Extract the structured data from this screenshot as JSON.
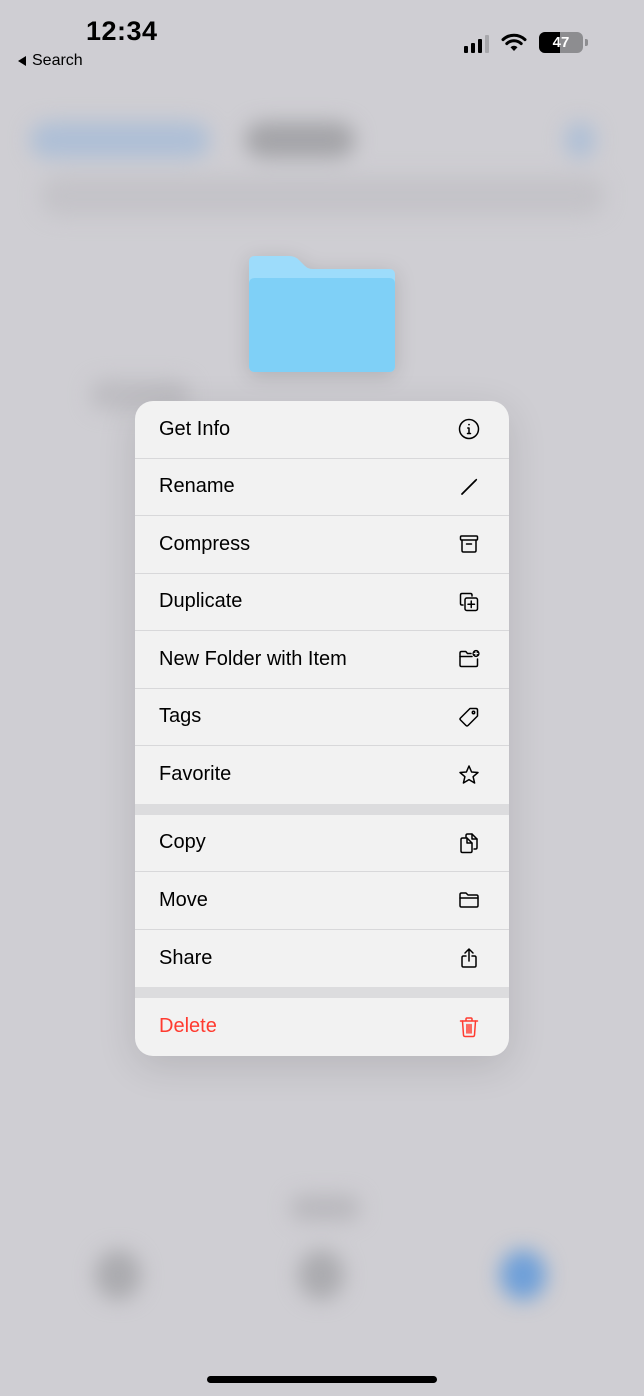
{
  "status_bar": {
    "time": "12:34",
    "back_label": "Search",
    "battery_percent": 47,
    "battery_label": "47",
    "signal_bars_active": 3,
    "signal_bars_total": 4
  },
  "preview": {
    "icon": "folder-icon",
    "folder_color": "#7fd0f7"
  },
  "menu": {
    "groups": [
      [
        {
          "label": "Get Info",
          "icon": "info-icon"
        },
        {
          "label": "Rename",
          "icon": "pencil-icon"
        },
        {
          "label": "Compress",
          "icon": "archive-box-icon"
        },
        {
          "label": "Duplicate",
          "icon": "duplicate-icon"
        },
        {
          "label": "New Folder with Item",
          "icon": "folder-plus-icon"
        },
        {
          "label": "Tags",
          "icon": "tag-icon"
        },
        {
          "label": "Favorite",
          "icon": "star-icon"
        }
      ],
      [
        {
          "label": "Copy",
          "icon": "copy-icon"
        },
        {
          "label": "Move",
          "icon": "folder-icon"
        },
        {
          "label": "Share",
          "icon": "share-icon"
        }
      ],
      [
        {
          "label": "Delete",
          "icon": "trash-icon",
          "destructive": true
        }
      ]
    ]
  },
  "colors": {
    "destructive": "#ff3b30",
    "menu_background": "#f2f2f2",
    "backdrop": "#cfced3"
  }
}
